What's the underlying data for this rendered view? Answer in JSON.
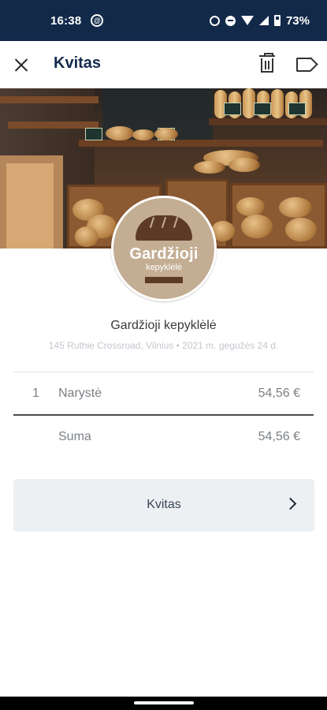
{
  "status_bar": {
    "time": "16:38",
    "battery": "73%",
    "icons": [
      "app-notification-icon",
      "alarm-icon",
      "do-not-disturb-icon",
      "wifi-icon",
      "signal-icon",
      "battery-icon"
    ]
  },
  "app_bar": {
    "title": "Kvitas",
    "icons": [
      "close-icon",
      "trash-icon",
      "tag-icon"
    ]
  },
  "logo": {
    "name": "Gardžioji",
    "subtitle": "kepyklėlė"
  },
  "merchant": {
    "name": "Gardžioji kepyklėlė",
    "address": "145 Ruthie Crossroad, Vilnius • 2021 m. gegužės 24 d."
  },
  "items": [
    {
      "qty": "1",
      "name": "Narystė",
      "price": "54,56 €"
    }
  ],
  "total": {
    "label": "Suma",
    "value": "54,56 €"
  },
  "receipt_button": {
    "label": "Kvitas",
    "icon": "chevron-right-icon"
  },
  "colors": {
    "status_bar": "#12294a",
    "title": "#152a4c",
    "logo_bg": "#c3ad93",
    "logo_brown": "#5d3a26",
    "button_bg": "#edf0f2"
  }
}
